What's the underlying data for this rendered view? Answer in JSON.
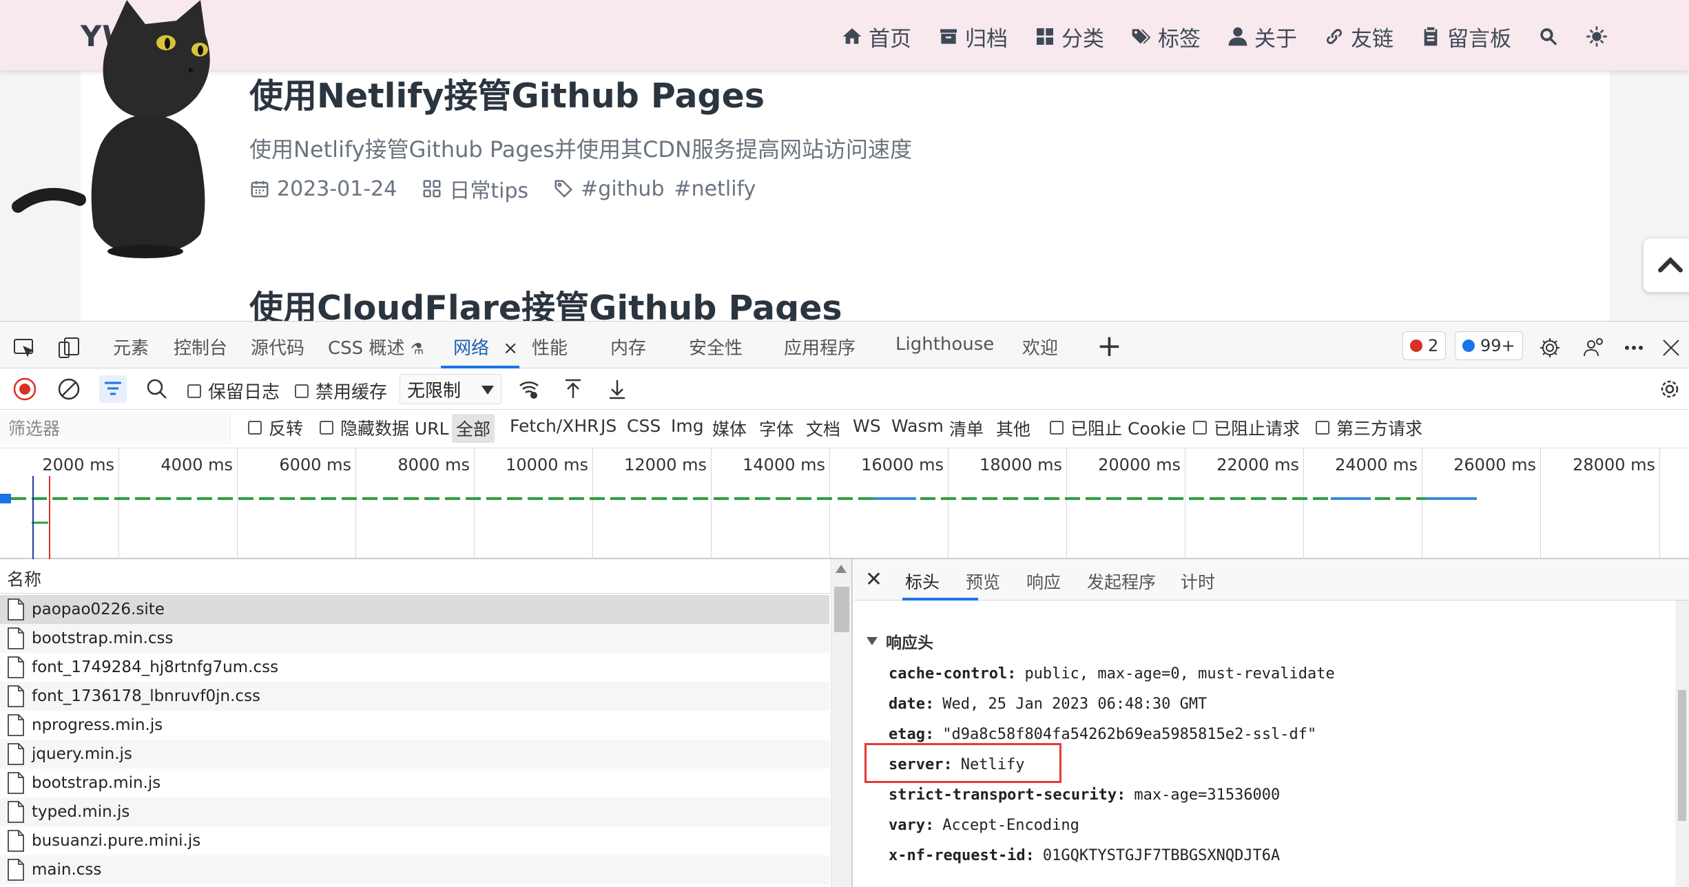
{
  "site": {
    "logo": "YWJ",
    "nav": [
      {
        "icon": "home-icon",
        "label": "首页"
      },
      {
        "icon": "archive-icon",
        "label": "归档"
      },
      {
        "icon": "grid-icon",
        "label": "分类"
      },
      {
        "icon": "tags-icon",
        "label": "标签"
      },
      {
        "icon": "user-icon",
        "label": "关于"
      },
      {
        "icon": "link-icon",
        "label": "友链"
      },
      {
        "icon": "clipboard-icon",
        "label": "留言板"
      }
    ],
    "nav_search_icon": "search-icon",
    "nav_theme_icon": "sun-icon",
    "posts": [
      {
        "title": "使用Netlify接管Github Pages",
        "description": "使用Netlify接管Github Pages并使用其CDN服务提高网站访问速度",
        "date": "2023-01-24",
        "category": "日常tips",
        "tags": [
          "#github",
          "#netlify"
        ]
      },
      {
        "title": "使用CloudFlare接管Github Pages"
      }
    ],
    "back_to_top_icon": "chevron-up-icon"
  },
  "devtools": {
    "tabs": {
      "elements": "元素",
      "console": "控制台",
      "sources": "源代码",
      "css_overview": "CSS 概述",
      "network": "网络",
      "performance": "性能",
      "memory": "内存",
      "security": "安全性",
      "application": "应用程序",
      "lighthouse": "Lighthouse",
      "welcome": "欢迎"
    },
    "error_count": "2",
    "message_count": "99+",
    "toolbar": {
      "preserve_log": "保留日志",
      "disable_cache": "禁用缓存",
      "throttling": "无限制"
    },
    "filter": {
      "placeholder": "筛选器",
      "invert": "反转",
      "hide_data_urls": "隐藏数据 URL",
      "types": [
        "全部",
        "Fetch/XHR",
        "JS",
        "CSS",
        "Img",
        "媒体",
        "字体",
        "文档",
        "WS",
        "Wasm",
        "清单",
        "其他"
      ],
      "active_type": "全部",
      "blocked_cookies": "已阻止 Cookie",
      "blocked_requests": "已阻止请求",
      "third_party": "第三方请求"
    },
    "overview_ticks": [
      "2000 ms",
      "4000 ms",
      "6000 ms",
      "8000 ms",
      "10000 ms",
      "12000 ms",
      "14000 ms",
      "16000 ms",
      "18000 ms",
      "20000 ms",
      "22000 ms",
      "24000 ms",
      "26000 ms",
      "28000 ms"
    ],
    "request_list": {
      "header": "名称",
      "items": [
        "paopao0226.site",
        "bootstrap.min.css",
        "font_1749284_hj8rtnfg7um.css",
        "font_1736178_lbnruvf0jn.css",
        "nprogress.min.js",
        "jquery.min.js",
        "bootstrap.min.js",
        "typed.min.js",
        "busuanzi.pure.mini.js",
        "main.css"
      ]
    },
    "detail": {
      "tabs": [
        "标头",
        "预览",
        "响应",
        "发起程序",
        "计时"
      ],
      "active_tab": "标头",
      "section_title": "响应头",
      "headers": [
        {
          "name": "cache-control:",
          "value": "public, max-age=0, must-revalidate"
        },
        {
          "name": "date:",
          "value": "Wed, 25 Jan 2023 06:48:30 GMT"
        },
        {
          "name": "etag:",
          "value": "\"d9a8c58f804fa54262b69ea5985815e2-ssl-df\""
        },
        {
          "name": "server:",
          "value": "Netlify"
        },
        {
          "name": "strict-transport-security:",
          "value": "max-age=31536000"
        },
        {
          "name": "vary:",
          "value": "Accept-Encoding"
        },
        {
          "name": "x-nf-request-id:",
          "value": "01GQKTYSTGJF7TBBGSXNQDJT6A"
        }
      ]
    }
  }
}
